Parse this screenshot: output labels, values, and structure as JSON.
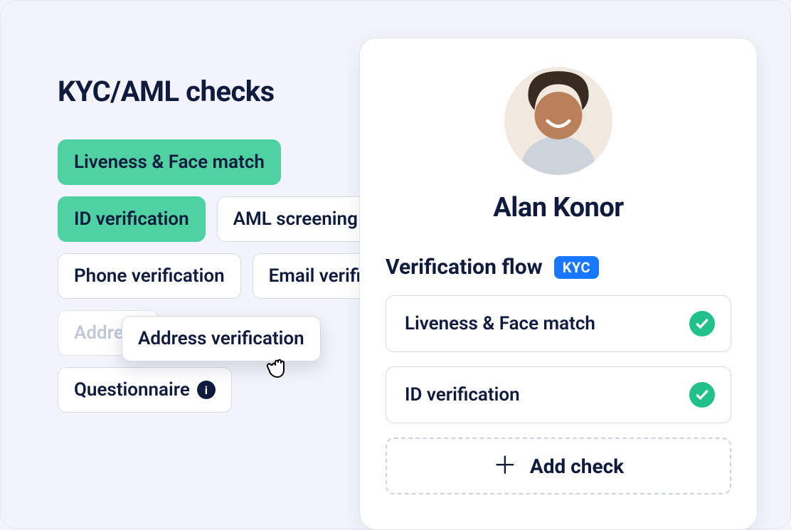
{
  "page_title": "KYC/AML checks",
  "chips": {
    "liveness": "Liveness & Face match",
    "id_verification": "ID verification",
    "aml_screening": "AML screening",
    "phone_verification": "Phone verification",
    "email_verification": "Email verification",
    "address_ghost": "Address",
    "questionnaire": "Questionnaire"
  },
  "drag_chip_label": "Address verification",
  "card": {
    "user_name": "Alan Konor",
    "flow_title": "Verification flow",
    "flow_badge": "KYC",
    "items": [
      {
        "label": "Liveness & Face match",
        "status": "passed"
      },
      {
        "label": "ID verification",
        "status": "passed"
      }
    ],
    "add_check_label": "Add check"
  },
  "colors": {
    "accent_green": "#4fd1a1",
    "success_green": "#22c08b",
    "badge_blue": "#1877ff",
    "text_primary": "#0f1b3d",
    "bg": "#f3f4fb"
  }
}
